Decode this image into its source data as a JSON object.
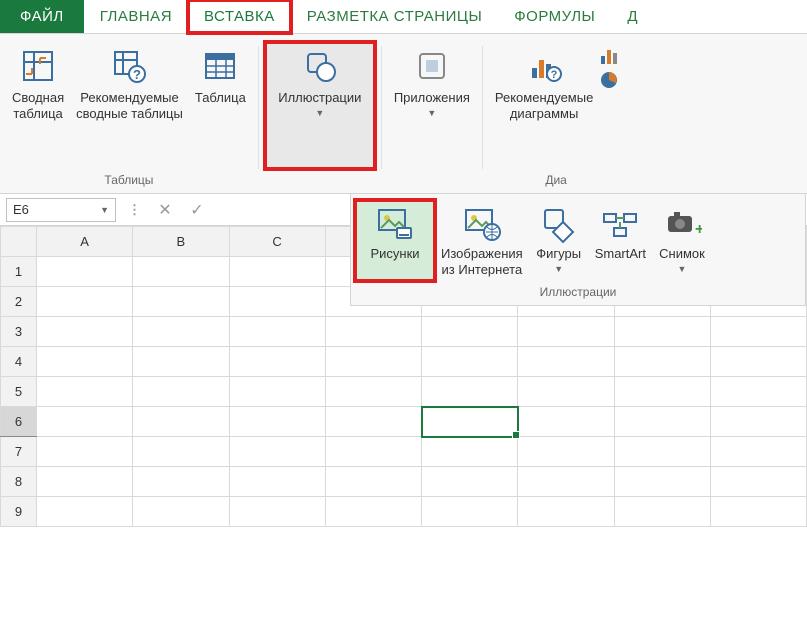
{
  "tabs": {
    "file": "ФАЙЛ",
    "home": "ГЛАВНАЯ",
    "insert": "ВСТАВКА",
    "page_layout": "РАЗМЕТКА СТРАНИЦЫ",
    "formulas": "ФОРМУЛЫ",
    "data_partial": "Д"
  },
  "ribbon": {
    "tables": {
      "pivot": "Сводная\nтаблица",
      "recommended": "Рекомендуемые\nсводные таблицы",
      "table": "Таблица",
      "group_label": "Таблицы"
    },
    "illustrations": {
      "button": "Иллюстрации"
    },
    "addins": {
      "button": "Приложения"
    },
    "charts": {
      "recommended": "Рекомендуемые\nдиаграммы",
      "group_partial": "Диа"
    }
  },
  "sub_ribbon": {
    "pictures": "Рисунки",
    "online_pictures": "Изображения\nиз Интернета",
    "shapes": "Фигуры",
    "smartart": "SmartArt",
    "screenshot": "Снимок",
    "group_label": "Иллюстрации"
  },
  "formula_bar": {
    "name_box": "E6"
  },
  "grid": {
    "columns": [
      "A",
      "B",
      "C"
    ],
    "rows": [
      "1",
      "2",
      "3",
      "4",
      "5",
      "6",
      "7",
      "8",
      "9"
    ],
    "active_row": "6"
  }
}
